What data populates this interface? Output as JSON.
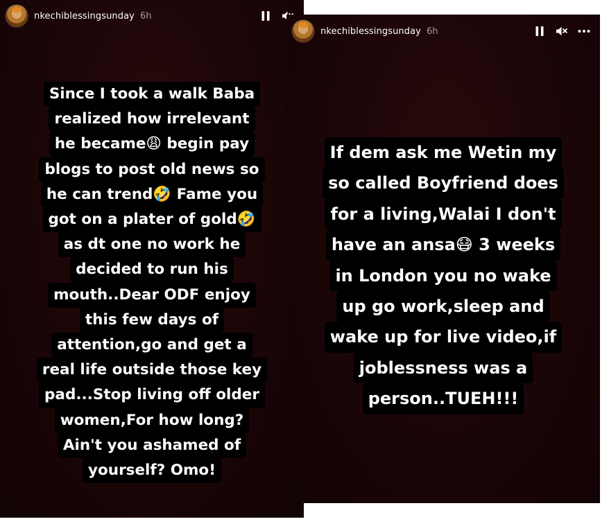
{
  "story_left": {
    "username": "nkechiblessingsunday",
    "time": "6h",
    "lines": [
      "Since I took a walk Baba",
      "realized how irrelevant",
      "he became😩 begin pay",
      "blogs to post old news so",
      "he can trend🤣 Fame you",
      "got on a plater of gold🤣",
      "as dt one no work he",
      "decided to run his",
      "mouth..Dear ODF enjoy",
      "this few days of",
      "attention,go and get a",
      "real life outside those key",
      "pad...Stop living off older",
      "women,For how long?",
      "Ain't you ashamed of",
      "yourself? Omo!"
    ]
  },
  "story_right": {
    "username": "nkechiblessingsunday",
    "time": "6h",
    "lines": [
      "If dem ask me Wetin my",
      "so called Boyfriend does",
      "for a living,Walai I don't",
      "have an ansa😷 3 weeks",
      "in London you no wake",
      "up go work,sleep and",
      "wake up for live video,if",
      "joblessness was a",
      "person..TUEH!!!"
    ]
  },
  "icons": {
    "pause": "pause-icon",
    "mute": "speaker-muted-icon",
    "more": "more-options-icon"
  },
  "colors": {
    "story_background": "#1d0608",
    "caption_highlight": "#000000",
    "text": "#ffffff"
  }
}
